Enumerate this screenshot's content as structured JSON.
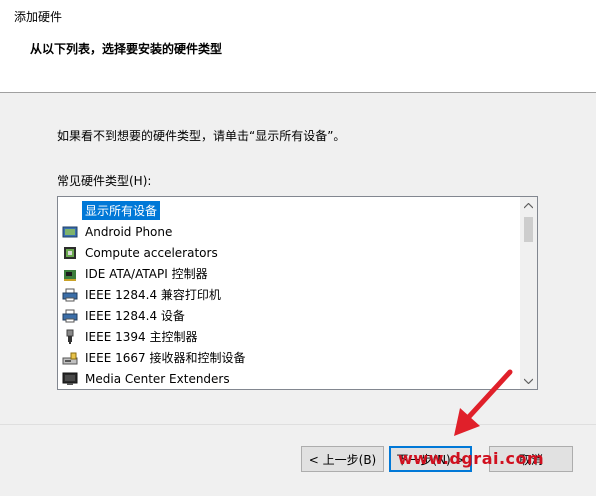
{
  "window": {
    "title": "添加硬件"
  },
  "header": {
    "heading": "从以下列表，选择要安装的硬件类型"
  },
  "body": {
    "instruction": "如果看不到想要的硬件类型，请单击“显示所有设备”。",
    "list_label": "常见硬件类型(H):"
  },
  "hardware_list": {
    "items": [
      {
        "label": "显示所有设备",
        "icon": "none",
        "selected": true
      },
      {
        "label": "Android Phone",
        "icon": "phone-icon"
      },
      {
        "label": "Compute accelerators",
        "icon": "chip-icon"
      },
      {
        "label": "IDE ATA/ATAPI 控制器",
        "icon": "ide-controller-icon"
      },
      {
        "label": "IEEE 1284.4 兼容打印机",
        "icon": "printer-icon"
      },
      {
        "label": "IEEE 1284.4 设备",
        "icon": "printer-icon"
      },
      {
        "label": "IEEE 1394 主控制器",
        "icon": "usb-plug-icon"
      },
      {
        "label": "IEEE 1667 接收器和控制设备",
        "icon": "drive-icon"
      },
      {
        "label": "Media Center Extenders",
        "icon": "monitor-icon"
      }
    ]
  },
  "footer": {
    "back_label": "< 上一步(B)",
    "next_label": "下一步(N) >",
    "cancel_label": "取消"
  },
  "watermark": {
    "text": "www.dgrai.com"
  },
  "colors": {
    "selection": "#0078d7",
    "watermark": "#d0101f",
    "dialog_bg": "#f0f0f0"
  }
}
